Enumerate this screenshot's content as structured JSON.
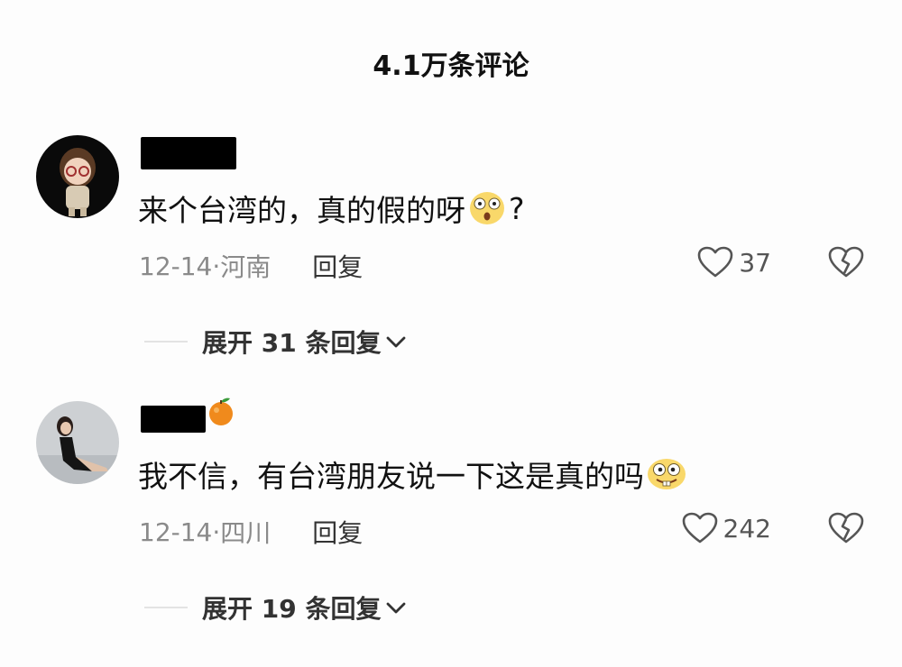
{
  "header": {
    "title": "4.1万条评论"
  },
  "comments": [
    {
      "text_before_emoji": "来个台湾的，真的假的呀",
      "text_after_emoji": "?",
      "emoji_icon": "astonished-face-emoji",
      "date": "12-14",
      "separator": "·",
      "location": "河南",
      "reply_label": "回复",
      "likes": "37",
      "expand_label": "展开 31 条回复"
    },
    {
      "text_before_emoji": "我不信，有台湾朋友说一下这是真的吗",
      "text_after_emoji": "",
      "emoji_icon": "goofy-face-emoji",
      "date": "12-14",
      "separator": "·",
      "location": "四川",
      "reply_label": "回复",
      "likes": "242",
      "expand_label": "展开 19 条回复"
    }
  ],
  "colors": {
    "meta_gray": "#8a8a8a",
    "text_dark": "#111111",
    "redaction": "#000000"
  }
}
